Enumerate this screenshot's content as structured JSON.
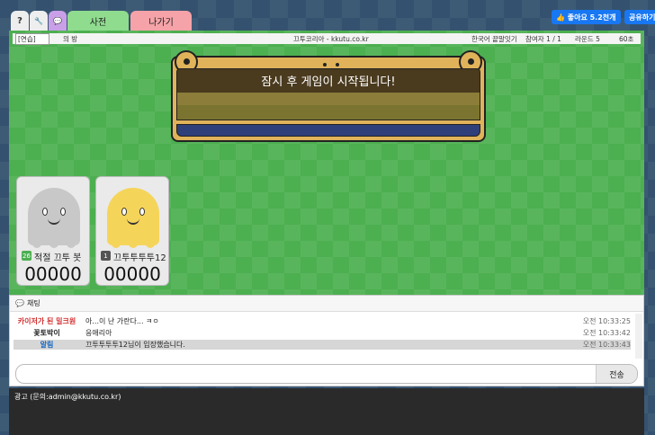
{
  "topbar": {
    "help": "?",
    "settings": "🔧",
    "chat": "💬",
    "tab_dict": "사전",
    "tab_exit": "나가기",
    "fb_like": "👍 좋아요 5.2천개",
    "fb_share": "공유하기"
  },
  "info": {
    "room_id": "[연습]",
    "room_label": "의 방",
    "site": "끄투코리아 - kkutu.co.kr",
    "mode": "한국어 끝말잇기",
    "players": "참여자 1 / 1",
    "rounds": "라운드 5",
    "time": "60초"
  },
  "board": {
    "message": "잠시 후 게임이 시작됩니다!"
  },
  "players": [
    {
      "level": "26",
      "name": "적절 끄투 봇",
      "score": "00000",
      "body_color": "#c8c8c8",
      "level_color": "#4caf50"
    },
    {
      "level": "1",
      "name": "끄투투투투12",
      "score": "00000",
      "body_color": "#f5d45a",
      "level_color": "#555555"
    }
  ],
  "chat": {
    "header": "채팅",
    "messages": [
      {
        "who": "카이저가 된 밀크원",
        "who_color": "#d32f2f",
        "text": "아...이 난 가란다... ㅋㅇ",
        "time": "오전 10:33:25"
      },
      {
        "who": "꽃토박이",
        "who_color": "#222222",
        "text": "응애리아",
        "time": "오전 10:33:42"
      },
      {
        "who": "알림",
        "who_color": "#1565c0",
        "text": "끄투투투투12님이 입장했습니다.",
        "time": "오전 10:33:43"
      }
    ],
    "input_placeholder": "",
    "send": "전송"
  },
  "ad": {
    "text": "광고 (문의:admin@kkutu.co.kr)"
  }
}
